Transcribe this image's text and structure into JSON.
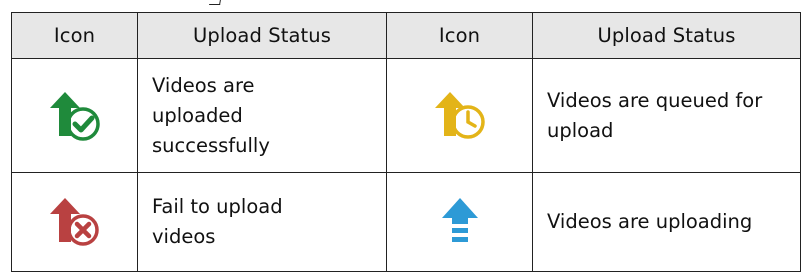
{
  "table": {
    "headers": [
      "Icon",
      "Upload Status",
      "Icon",
      "Upload Status"
    ],
    "rows": [
      [
        {
          "icon": "green-upload-check-icon",
          "color": "#1f8a3b",
          "lines": [
            "Videos are",
            "uploaded",
            "successfully"
          ]
        },
        {
          "icon": "yellow-upload-clock-icon",
          "color": "#e3b418",
          "lines": [
            "Videos are queued for",
            "upload"
          ]
        }
      ],
      [
        {
          "icon": "red-upload-failed-icon",
          "color": "#b94141",
          "lines": [
            "Fail to upload",
            "videos"
          ]
        },
        {
          "icon": "blue-uploading-icon",
          "color": "#2d9ad6",
          "lines": [
            "Videos are uploading"
          ]
        }
      ]
    ]
  }
}
